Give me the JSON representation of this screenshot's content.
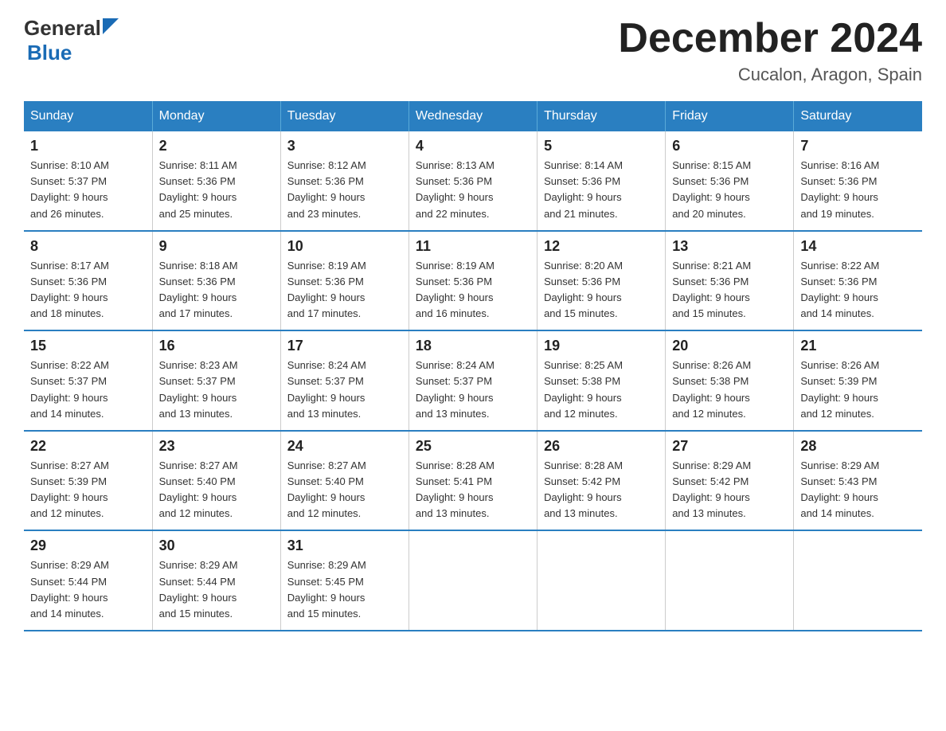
{
  "header": {
    "logo_general": "General",
    "logo_blue": "Blue",
    "main_title": "December 2024",
    "subtitle": "Cucalon, Aragon, Spain"
  },
  "days_of_week": [
    "Sunday",
    "Monday",
    "Tuesday",
    "Wednesday",
    "Thursday",
    "Friday",
    "Saturday"
  ],
  "weeks": [
    [
      {
        "day": "1",
        "sunrise": "8:10 AM",
        "sunset": "5:37 PM",
        "daylight": "9 hours and 26 minutes."
      },
      {
        "day": "2",
        "sunrise": "8:11 AM",
        "sunset": "5:36 PM",
        "daylight": "9 hours and 25 minutes."
      },
      {
        "day": "3",
        "sunrise": "8:12 AM",
        "sunset": "5:36 PM",
        "daylight": "9 hours and 23 minutes."
      },
      {
        "day": "4",
        "sunrise": "8:13 AM",
        "sunset": "5:36 PM",
        "daylight": "9 hours and 22 minutes."
      },
      {
        "day": "5",
        "sunrise": "8:14 AM",
        "sunset": "5:36 PM",
        "daylight": "9 hours and 21 minutes."
      },
      {
        "day": "6",
        "sunrise": "8:15 AM",
        "sunset": "5:36 PM",
        "daylight": "9 hours and 20 minutes."
      },
      {
        "day": "7",
        "sunrise": "8:16 AM",
        "sunset": "5:36 PM",
        "daylight": "9 hours and 19 minutes."
      }
    ],
    [
      {
        "day": "8",
        "sunrise": "8:17 AM",
        "sunset": "5:36 PM",
        "daylight": "9 hours and 18 minutes."
      },
      {
        "day": "9",
        "sunrise": "8:18 AM",
        "sunset": "5:36 PM",
        "daylight": "9 hours and 17 minutes."
      },
      {
        "day": "10",
        "sunrise": "8:19 AM",
        "sunset": "5:36 PM",
        "daylight": "9 hours and 17 minutes."
      },
      {
        "day": "11",
        "sunrise": "8:19 AM",
        "sunset": "5:36 PM",
        "daylight": "9 hours and 16 minutes."
      },
      {
        "day": "12",
        "sunrise": "8:20 AM",
        "sunset": "5:36 PM",
        "daylight": "9 hours and 15 minutes."
      },
      {
        "day": "13",
        "sunrise": "8:21 AM",
        "sunset": "5:36 PM",
        "daylight": "9 hours and 15 minutes."
      },
      {
        "day": "14",
        "sunrise": "8:22 AM",
        "sunset": "5:36 PM",
        "daylight": "9 hours and 14 minutes."
      }
    ],
    [
      {
        "day": "15",
        "sunrise": "8:22 AM",
        "sunset": "5:37 PM",
        "daylight": "9 hours and 14 minutes."
      },
      {
        "day": "16",
        "sunrise": "8:23 AM",
        "sunset": "5:37 PM",
        "daylight": "9 hours and 13 minutes."
      },
      {
        "day": "17",
        "sunrise": "8:24 AM",
        "sunset": "5:37 PM",
        "daylight": "9 hours and 13 minutes."
      },
      {
        "day": "18",
        "sunrise": "8:24 AM",
        "sunset": "5:37 PM",
        "daylight": "9 hours and 13 minutes."
      },
      {
        "day": "19",
        "sunrise": "8:25 AM",
        "sunset": "5:38 PM",
        "daylight": "9 hours and 12 minutes."
      },
      {
        "day": "20",
        "sunrise": "8:26 AM",
        "sunset": "5:38 PM",
        "daylight": "9 hours and 12 minutes."
      },
      {
        "day": "21",
        "sunrise": "8:26 AM",
        "sunset": "5:39 PM",
        "daylight": "9 hours and 12 minutes."
      }
    ],
    [
      {
        "day": "22",
        "sunrise": "8:27 AM",
        "sunset": "5:39 PM",
        "daylight": "9 hours and 12 minutes."
      },
      {
        "day": "23",
        "sunrise": "8:27 AM",
        "sunset": "5:40 PM",
        "daylight": "9 hours and 12 minutes."
      },
      {
        "day": "24",
        "sunrise": "8:27 AM",
        "sunset": "5:40 PM",
        "daylight": "9 hours and 12 minutes."
      },
      {
        "day": "25",
        "sunrise": "8:28 AM",
        "sunset": "5:41 PM",
        "daylight": "9 hours and 13 minutes."
      },
      {
        "day": "26",
        "sunrise": "8:28 AM",
        "sunset": "5:42 PM",
        "daylight": "9 hours and 13 minutes."
      },
      {
        "day": "27",
        "sunrise": "8:29 AM",
        "sunset": "5:42 PM",
        "daylight": "9 hours and 13 minutes."
      },
      {
        "day": "28",
        "sunrise": "8:29 AM",
        "sunset": "5:43 PM",
        "daylight": "9 hours and 14 minutes."
      }
    ],
    [
      {
        "day": "29",
        "sunrise": "8:29 AM",
        "sunset": "5:44 PM",
        "daylight": "9 hours and 14 minutes."
      },
      {
        "day": "30",
        "sunrise": "8:29 AM",
        "sunset": "5:44 PM",
        "daylight": "9 hours and 15 minutes."
      },
      {
        "day": "31",
        "sunrise": "8:29 AM",
        "sunset": "5:45 PM",
        "daylight": "9 hours and 15 minutes."
      },
      null,
      null,
      null,
      null
    ]
  ],
  "labels": {
    "sunrise_label": "Sunrise:",
    "sunset_label": "Sunset:",
    "daylight_label": "Daylight:"
  }
}
